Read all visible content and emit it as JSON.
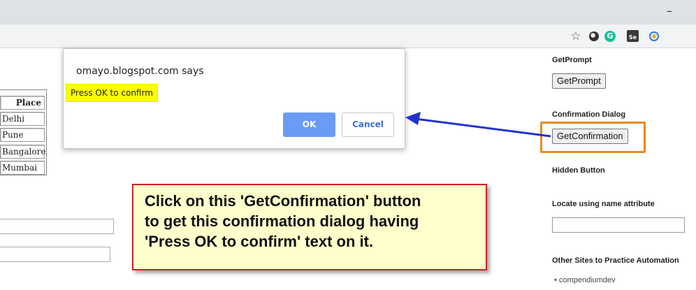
{
  "browser": {
    "minimize_glyph": "–",
    "toolbar_icons": [
      "star-icon",
      "circle-extension-icon",
      "grammarly-icon",
      "selenium-ide-icon",
      "extension-icon"
    ],
    "grammarly_letter": "G",
    "selenium_label": "Se"
  },
  "left_table": {
    "header": "Place",
    "rows": [
      "Delhi",
      "Pune",
      "Bangalore",
      "Mumbai"
    ]
  },
  "dialog": {
    "title": "omayo.blogspot.com says",
    "message": "Press OK to confirm",
    "ok_label": "OK",
    "cancel_label": "Cancel"
  },
  "sidebar": {
    "get_prompt_heading": "GetPrompt",
    "get_prompt_button": "GetPrompt",
    "confirmation_heading": "Confirmation Dialog",
    "get_confirmation_button": "GetConfirmation",
    "hidden_button_heading": "Hidden Button",
    "locate_name_heading": "Locate using name attribute",
    "other_sites_heading": "Other Sites to Practice Automation",
    "other_sites_items": [
      "compendiumdev"
    ]
  },
  "annotation": {
    "lines": [
      "Click on this 'GetConfirmation' button",
      "to get this confirmation dialog having",
      "'Press OK to confirm' text on it."
    ]
  },
  "colors": {
    "highlight": "#ffff00",
    "ok_button": "#6a9cf5",
    "orange_box": "#e98a22",
    "arrow": "#2233cc",
    "callout_border": "#cc2222",
    "callout_bg": "#ffffcc"
  }
}
